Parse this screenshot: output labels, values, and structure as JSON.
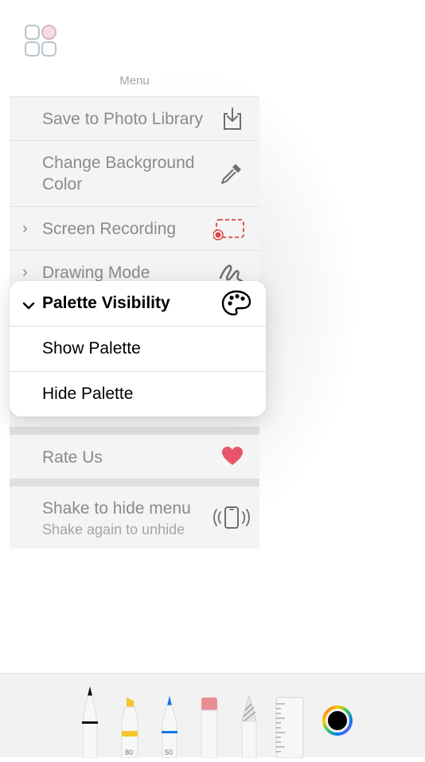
{
  "menu": {
    "title": "Menu",
    "items": [
      {
        "label": "Save to Photo Library",
        "icon": "download-icon"
      },
      {
        "label_line1": "Change Background",
        "label_line2": "Color",
        "icon": "eyedropper-icon"
      },
      {
        "label": "Screen Recording",
        "icon": "screen-recording-icon"
      },
      {
        "label": "Drawing Mode",
        "icon": "scribble-icon"
      },
      {
        "label": "Rate Us",
        "icon": "heart-icon"
      },
      {
        "label": "Shake to hide menu",
        "sublabel": "Shake again to unhide",
        "icon": "shake-phone-icon"
      }
    ]
  },
  "palette_menu": {
    "header": "Palette Visibility",
    "icon": "palette-icon",
    "options": [
      "Show Palette",
      "Hide Palette"
    ]
  },
  "toolbar": {
    "tools": [
      {
        "name": "pen",
        "label": ""
      },
      {
        "name": "marker",
        "label": "80"
      },
      {
        "name": "pencil",
        "label": "50"
      },
      {
        "name": "eraser",
        "label": ""
      },
      {
        "name": "lasso",
        "label": ""
      },
      {
        "name": "ruler",
        "label": ""
      }
    ],
    "current_color": "#000000"
  },
  "colors": {
    "heart": "#e8556a",
    "recording": "#e04545",
    "marker_yellow": "#f5c52c",
    "pencil_blue": "#1a73e8",
    "eraser_pink": "#e88f94"
  }
}
